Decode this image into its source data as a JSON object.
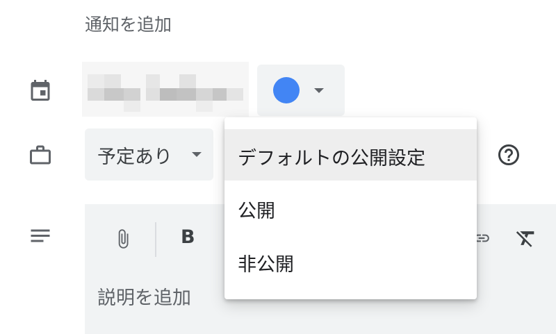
{
  "notification": {
    "add_label": "通知を追加"
  },
  "color": {
    "selected": "#4285f4",
    "caret_color": "#5f6368"
  },
  "availability": {
    "selected": "予定あり"
  },
  "visibility_menu": {
    "items": [
      {
        "label": "デフォルトの公開設定",
        "selected": true
      },
      {
        "label": "公開",
        "selected": false
      },
      {
        "label": "非公開",
        "selected": false
      }
    ]
  },
  "editor": {
    "placeholder": "説明を追加",
    "toolbar": {
      "bold_label": "B"
    }
  },
  "icons": {
    "calendar": "calendar-icon",
    "availability": "briefcase-icon",
    "description": "notes-icon",
    "help": "help-icon",
    "attach": "paperclip-icon",
    "link": "link-icon",
    "clear_format": "clear-formatting-icon"
  },
  "colors": {
    "field_bg": "#f1f3f4",
    "menu_selected_bg": "#eeeeee",
    "icon_color": "#5f6368",
    "text_primary": "#202124"
  }
}
